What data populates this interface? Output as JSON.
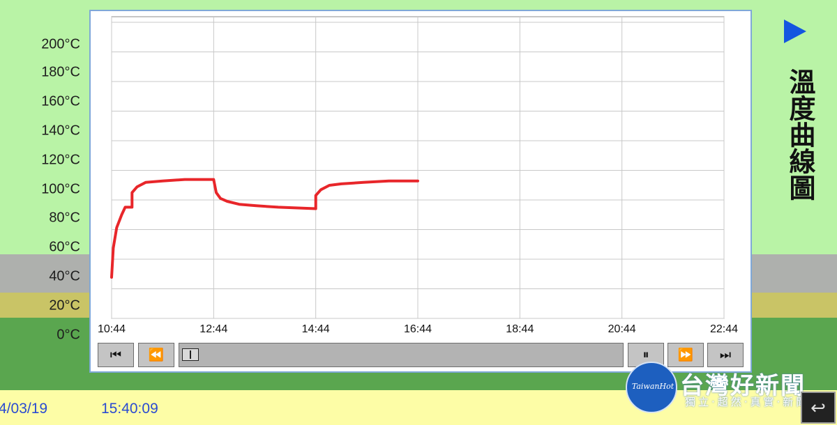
{
  "side_title": "溫度曲線圖",
  "footer": {
    "date": "4/03/19",
    "time": "15:40:09"
  },
  "watermark": {
    "logo_text": "TaiwanHot",
    "main": "台灣好新聞",
    "sub": "獨立‧超然‧真實‧新聞"
  },
  "controls": {
    "first_icon": "skip-to-start-icon",
    "rewind_icon": "rewind-icon",
    "pause_icon": "pause-icon",
    "forward_icon": "fast-forward-icon",
    "last_icon": "skip-to-end-icon",
    "first_glyph": "⏮",
    "rewind_glyph": "⏪",
    "pause_glyph": "⏸",
    "forward_glyph": "⏩",
    "last_glyph": "⏭"
  },
  "back_glyph": "↩",
  "colors": {
    "series": "#e8262a",
    "accent": "#1456e0"
  },
  "chart_data": {
    "type": "line",
    "title": "溫度曲線圖",
    "x_ticks": [
      "10:44",
      "12:44",
      "14:44",
      "16:44",
      "18:44",
      "20:44",
      "22:44"
    ],
    "y_ticks": [
      "0°C",
      "20°C",
      "40°C",
      "60°C",
      "80°C",
      "100°C",
      "120°C",
      "140°C",
      "160°C",
      "180°C",
      "200°C"
    ],
    "xlim_minutes_from_start": [
      0,
      720
    ],
    "ylim": [
      0,
      200
    ],
    "grid": true,
    "series": [
      {
        "values_time": [
          "10:44",
          "10:46",
          "10:50",
          "10:56",
          "11:00",
          "11:08",
          "11:08",
          "11:14",
          "11:24",
          "11:44",
          "12:10",
          "12:44",
          "12:47",
          "12:52",
          "13:00",
          "13:14",
          "13:34",
          "14:00",
          "14:44",
          "14:44",
          "14:50",
          "15:00",
          "15:14",
          "15:40",
          "16:10",
          "16:44"
        ],
        "values_temp": [
          32,
          52,
          66,
          75,
          80,
          80,
          90,
          94,
          97,
          98,
          99,
          99,
          90,
          86,
          84,
          82,
          81,
          80,
          79,
          88,
          92,
          95,
          96,
          97,
          98,
          98
        ]
      }
    ]
  }
}
